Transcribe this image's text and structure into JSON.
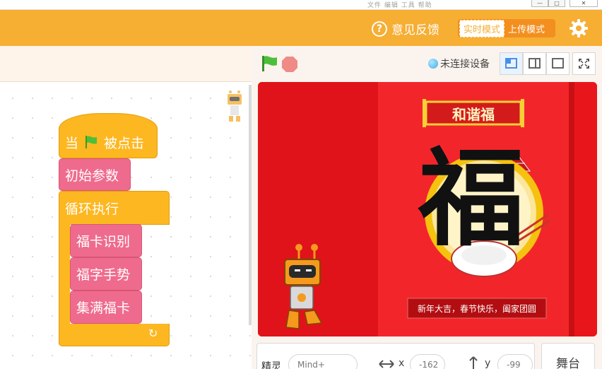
{
  "window": {
    "menu_text": "文件 编辑 工具 帮助",
    "minimize_glyph": "—",
    "restore_glyph": "□",
    "close_glyph": "✕"
  },
  "header": {
    "feedback_label": "意见反馈",
    "mode_realtime": "实时模式",
    "mode_upload": "上传模式",
    "settings_icon": "gear-icon",
    "brand_color": "#f6ae33"
  },
  "scripts": {
    "hat_when": "当",
    "hat_clicked": "被点击",
    "init_params": "初始参数",
    "loop": "循环执行",
    "blessing_card_recognition": "福卡识别",
    "fu_gesture": "福字手势",
    "collect_cards": "集满福卡",
    "loop_arrow_glyph": "↻"
  },
  "stage_controls": {
    "green_flag_icon": "green-flag-icon",
    "stop_icon": "stop-icon",
    "device_status": "未连接设备"
  },
  "stage": {
    "banner_title": "和谐福",
    "big_character": "福",
    "greeting": "新年大吉，春节快乐，阖家团圆"
  },
  "sprite": {
    "label": "精灵",
    "name": "Mind+",
    "x_label": "x",
    "x_value": "-162",
    "y_label": "y",
    "y_value": "-99"
  },
  "stage_tab_label": "舞台"
}
